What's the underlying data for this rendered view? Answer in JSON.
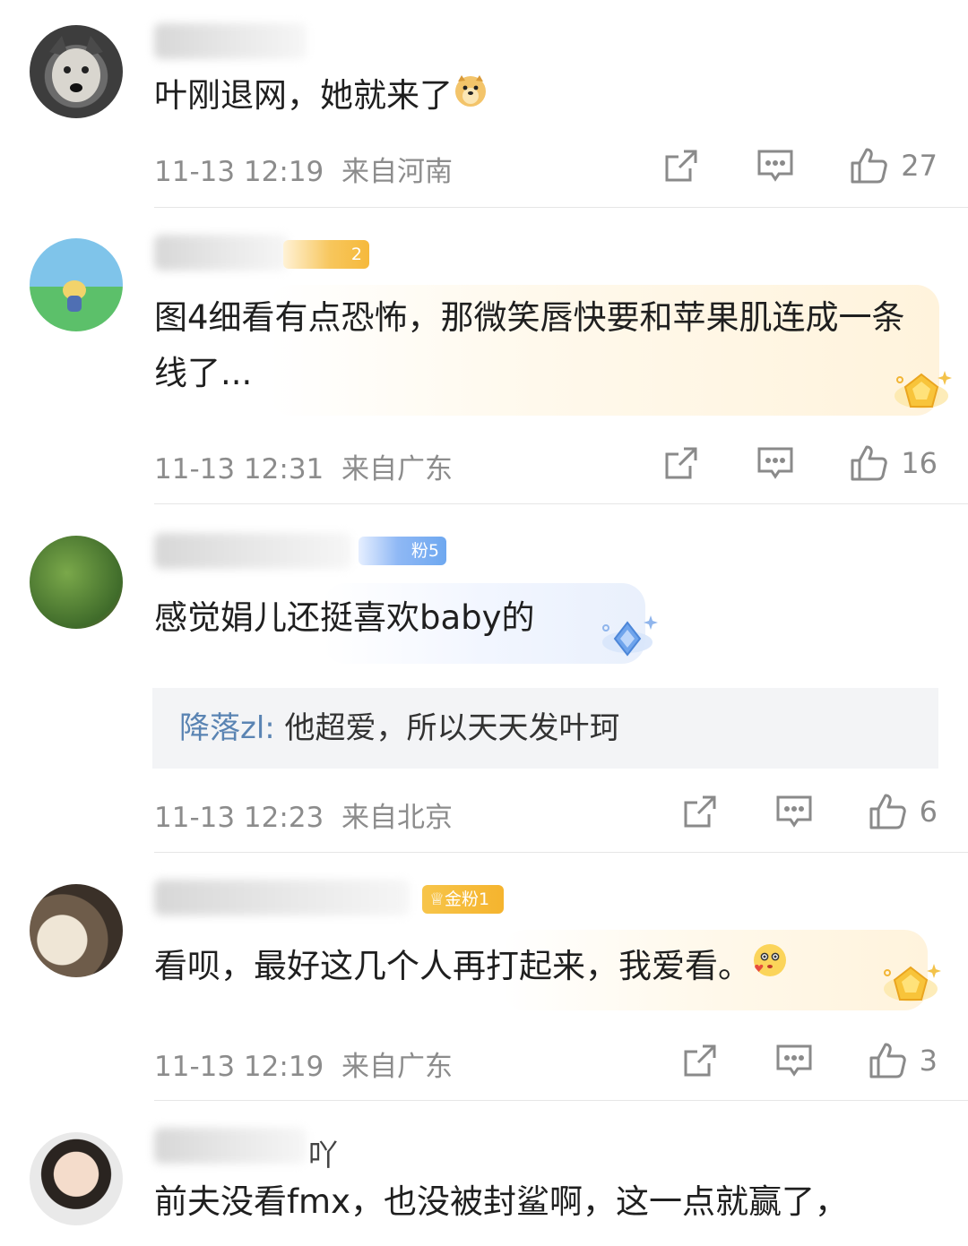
{
  "comments": [
    {
      "text": "叶刚退网，她就来了",
      "emoji": "doge-emoji",
      "time": "11-13 12:19",
      "location": "来自河南",
      "likes": "27"
    },
    {
      "badge": "2",
      "text": "图4细看有点恐怖，那微笑唇快要和苹果肌连成一条线了...",
      "time": "11-13 12:31",
      "location": "来自广东",
      "likes": "16"
    },
    {
      "badge": "粉5",
      "text": "感觉娟儿还挺喜欢baby的",
      "reply": {
        "name": "降落zl:",
        "text": " 他超爱，所以天天发叶珂"
      },
      "time": "11-13 12:23",
      "location": "来自北京",
      "likes": "6"
    },
    {
      "badge": "金粉1",
      "text": "看呗，最好这几个人再打起来，我爱看。",
      "emoji": "blushing-face-emoji",
      "time": "11-13 12:19",
      "location": "来自广东",
      "likes": "3"
    },
    {
      "name_fragment": "吖",
      "text": "前夫没看fmx，也没被封鲨啊，这一点就赢了，"
    }
  ],
  "icons": [
    "share-icon",
    "comment-icon",
    "like-icon"
  ],
  "colors": {
    "meta": "#8c8c8c",
    "reply_name": "#5a84b3",
    "gold_badge": "#f7b731",
    "blue_badge": "#6ea8f0"
  }
}
